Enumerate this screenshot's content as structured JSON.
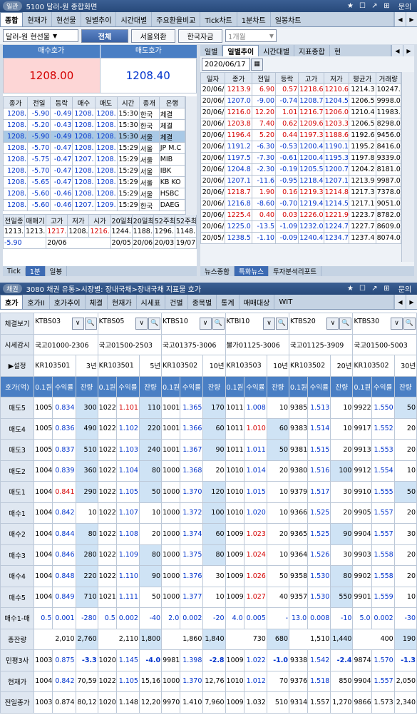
{
  "w1": {
    "tag": "일관",
    "title": "5100 달러-원 종합화면",
    "btns": [
      "★",
      "☐",
      "↗",
      "⊞",
      "문의"
    ],
    "tabs": [
      "종합",
      "현재가",
      "현선물",
      "일별추이",
      "시간대별",
      "주요환율비교",
      "Tick차트",
      "1분차트",
      "일봉차트"
    ],
    "sel": "달러-원 현선물",
    "b1": "전체",
    "b2": "서울외환",
    "b3": "한국자금",
    "b4": "1개월",
    "bid_label": "매수호가",
    "ask_label": "매도호가",
    "bid": "1208.00",
    "ask": "1208.40",
    "left_cols": [
      "종가",
      "전일",
      "등락",
      "매수",
      "매도",
      "시간",
      "종개",
      "은행"
    ],
    "left_rows": [
      [
        "1208.",
        "-5.90",
        "-0.49",
        "1208.",
        "1208.",
        "15:30",
        "한국",
        "체결"
      ],
      [
        "1208.",
        "-5.20",
        "-0.43",
        "1208.",
        "1208.",
        "15:30",
        "한국",
        "체결"
      ],
      [
        "1208.",
        "-5.90",
        "-0.49",
        "1208.",
        "1208.",
        "15:30",
        "서울",
        "체결"
      ],
      [
        "1208.",
        "-5.70",
        "-0.47",
        "1208.",
        "1208.",
        "15:29",
        "서울",
        "JP M.C"
      ],
      [
        "1208.",
        "-5.75",
        "-0.47",
        "1207.",
        "1208.",
        "15:29",
        "서울",
        "MIB"
      ],
      [
        "1208.",
        "-5.70",
        "-0.47",
        "1208.",
        "1208.",
        "15:29",
        "서울",
        "IBK"
      ],
      [
        "1208.",
        "-5.65",
        "-0.47",
        "1208.",
        "1208.",
        "15:29",
        "서울",
        "KB KO"
      ],
      [
        "1208.",
        "-5.60",
        "-0.46",
        "1208.",
        "1208.",
        "15:29",
        "서울",
        "HSBC"
      ],
      [
        "1208.",
        "-5.60",
        "-0.46",
        "1207.",
        "1209.",
        "15:29",
        "한국",
        "DAEG"
      ]
    ],
    "sum_cols": [
      "전일종",
      "매매기",
      "고가",
      "저가",
      "시가",
      "20일최",
      "20일최",
      "52주최",
      "52주최"
    ],
    "sum_r1": [
      "1213.",
      "1213.",
      "1217.",
      "1208.",
      "1216.",
      "1244.",
      "1188.",
      "1296.",
      "1148."
    ],
    "sum_r2": [
      "-5.90",
      "20/06",
      "20/05",
      "20/06",
      "20/03",
      "19/07"
    ],
    "right_tabs": [
      "일별",
      "일별추이",
      "시간대별",
      "지표종합",
      "현"
    ],
    "date": "2020/06/17",
    "right_cols": [
      "일자",
      "종가",
      "전일",
      "등락",
      "고가",
      "저가",
      "평균가",
      "거래량"
    ],
    "right_rows": [
      [
        "20/06/",
        "1213.9",
        "6.90",
        "0.57",
        "1218.6",
        "1210.6",
        "1214.3",
        "10247."
      ],
      [
        "20/06/",
        "1207.0",
        "-9.00",
        "-0.74",
        "1208.7",
        "1204.5",
        "1206.5",
        "9998.0"
      ],
      [
        "20/06/",
        "1216.0",
        "12.20",
        "1.01",
        "1216.7",
        "1206.0",
        "1210.4",
        "11983."
      ],
      [
        "20/06/",
        "1203.8",
        "7.40",
        "0.62",
        "1209.6",
        "1203.3",
        "1206.5",
        "8298.0"
      ],
      [
        "20/06/",
        "1196.4",
        "5.20",
        "0.44",
        "1197.3",
        "1188.6",
        "1192.6",
        "9456.0"
      ],
      [
        "20/06/",
        "1191.2",
        "-6.30",
        "-0.53",
        "1200.4",
        "1190.1",
        "1195.2",
        "8416.0"
      ],
      [
        "20/06/",
        "1197.5",
        "-7.30",
        "-0.61",
        "1200.4",
        "1195.3",
        "1197.8",
        "9339.0"
      ],
      [
        "20/06/",
        "1204.8",
        "-2.30",
        "-0.19",
        "1205.5",
        "1200.7",
        "1204.2",
        "8181.0"
      ],
      [
        "20/06/",
        "1207.1",
        "-11.6",
        "-0.95",
        "1218.4",
        "1207.1",
        "1213.9",
        "9987.0"
      ],
      [
        "20/06/",
        "1218.7",
        "1.90",
        "0.16",
        "1219.3",
        "1214.8",
        "1217.3",
        "7378.0"
      ],
      [
        "20/06/",
        "1216.8",
        "-8.60",
        "-0.70",
        "1219.4",
        "1214.5",
        "1217.1",
        "9051.0"
      ],
      [
        "20/06/",
        "1225.4",
        "0.40",
        "0.03",
        "1226.0",
        "1221.9",
        "1223.7",
        "8782.0"
      ],
      [
        "20/06/",
        "1225.0",
        "-13.5",
        "-1.09",
        "1232.0",
        "1224.7",
        "1227.7",
        "8609.0"
      ],
      [
        "20/05/",
        "1238.5",
        "-1.10",
        "-0.09",
        "1240.4",
        "1234.7",
        "1237.4",
        "8074.0"
      ]
    ],
    "left_bottom_tabs": [
      "Tick",
      "1분",
      "일봉"
    ],
    "right_bottom_tabs": [
      "뉴스종합",
      "특화뉴스",
      "투자분석리포트"
    ]
  },
  "w2": {
    "tag": "채권",
    "title": "3080 채권 유통>시장별: 장내국채>장내국채 지표물 호가",
    "btns": [
      "★",
      "☐",
      "↗",
      "⊞",
      "문의"
    ],
    "tabs": [
      "호가",
      "호가II",
      "호가추이",
      "체결",
      "현재가",
      "시세표",
      "건별",
      "종목별",
      "통계",
      "매매대상",
      "WIT"
    ],
    "side": [
      "체결보기",
      "시세감시",
      "설정",
      "호가(억)",
      "매도5",
      "매도4",
      "매도3",
      "매도2",
      "매도1",
      "매수1",
      "매수2",
      "매수3",
      "매수4",
      "매수5",
      "매수1-매",
      "총잔량",
      "민평3사",
      "현재가",
      "전일종가"
    ],
    "cols": [
      {
        "code": "KTBS03",
        "name": "국고01000-2306",
        "isin": "KR103501",
        "term": "3년",
        "q": [
          [
            "1005",
            "0.834",
            "300",
            "b"
          ],
          [
            "1005",
            "0.836",
            "490",
            "b"
          ],
          [
            "1005",
            "0.837",
            "510",
            "b"
          ],
          [
            "1004",
            "0.839",
            "360",
            "b"
          ],
          [
            "1004",
            "0.841",
            "290",
            "r"
          ],
          [
            "1004",
            "0.842",
            "10",
            "b"
          ],
          [
            "1004",
            "0.844",
            "80",
            "b"
          ],
          [
            "1004",
            "0.846",
            "280",
            "b"
          ],
          [
            "1004",
            "0.848",
            "220",
            "b"
          ],
          [
            "1004",
            "0.849",
            "710",
            "b"
          ]
        ],
        "diff": [
          "0.5",
          "0.001",
          "-280"
        ],
        "tot": [
          "2,010",
          "2,760"
        ],
        "mp": [
          "1003",
          "0.875",
          "-3.3"
        ],
        "cur": [
          "1004",
          "0.842",
          "70,59"
        ],
        "prev": [
          "1003",
          "0.874",
          "80,12"
        ]
      },
      {
        "code": "KTBS05",
        "name": "국고01500-2503",
        "isin": "KR103501",
        "term": "5년",
        "q": [
          [
            "1022",
            "1.101",
            "110",
            "r"
          ],
          [
            "1022",
            "1.102",
            "220",
            "b"
          ],
          [
            "1022",
            "1.103",
            "240",
            "b"
          ],
          [
            "1022",
            "1.104",
            "80",
            "b"
          ],
          [
            "1022",
            "1.105",
            "50",
            "b"
          ],
          [
            "1022",
            "1.107",
            "10",
            "b"
          ],
          [
            "1022",
            "1.108",
            "20",
            "b"
          ],
          [
            "1022",
            "1.109",
            "80",
            "b"
          ],
          [
            "1022",
            "1.110",
            "90",
            "b"
          ],
          [
            "1021",
            "1.111",
            "50",
            "b"
          ]
        ],
        "diff": [
          "0.5",
          "0.002",
          "-40"
        ],
        "tot": [
          "2,110",
          "1,800"
        ],
        "mp": [
          "1020",
          "1.145",
          "-4.0"
        ],
        "cur": [
          "1022",
          "1.105",
          "15,16"
        ],
        "prev": [
          "1020",
          "1.148",
          "12,20"
        ]
      },
      {
        "code": "KTBS10",
        "name": "국고01375-3006",
        "isin": "KR103502",
        "term": "10년",
        "q": [
          [
            "1001",
            "1.365",
            "170",
            "b"
          ],
          [
            "1001",
            "1.366",
            "60",
            "b"
          ],
          [
            "1001",
            "1.367",
            "90",
            "b"
          ],
          [
            "1000",
            "1.368",
            "20",
            "b"
          ],
          [
            "1000",
            "1.370",
            "120",
            "b"
          ],
          [
            "1000",
            "1.372",
            "100",
            "b"
          ],
          [
            "1000",
            "1.374",
            "60",
            "b"
          ],
          [
            "1000",
            "1.375",
            "80",
            "b"
          ],
          [
            "1000",
            "1.376",
            "30",
            "b"
          ],
          [
            "1000",
            "1.377",
            "10",
            "b"
          ]
        ],
        "diff": [
          "2.0",
          "0.002",
          "-20"
        ],
        "tot": [
          "1,860",
          "1,840"
        ],
        "mp": [
          "9981",
          "1.398",
          "-2.8"
        ],
        "cur": [
          "1000",
          "1.370",
          "12,76"
        ],
        "prev": [
          "9970",
          "1.410",
          "7,960"
        ]
      },
      {
        "code": "KTBI10",
        "name": "물가01125-3006",
        "isin": "KR103503",
        "term": "10년",
        "q": [
          [
            "1011",
            "1.008",
            "10",
            "b"
          ],
          [
            "1011",
            "1.010",
            "60",
            "r"
          ],
          [
            "1011",
            "1.011",
            "50",
            "b"
          ],
          [
            "1010",
            "1.014",
            "20",
            "b"
          ],
          [
            "1010",
            "1.015",
            "10",
            "b"
          ],
          [
            "1010",
            "1.020",
            "10",
            "b"
          ],
          [
            "1009",
            "1.023",
            "20",
            "r"
          ],
          [
            "1009",
            "1.024",
            "10",
            "r"
          ],
          [
            "1009",
            "1.026",
            "50",
            "r"
          ],
          [
            "1009",
            "1.027",
            "40",
            "r"
          ]
        ],
        "diff": [
          "4.0",
          "0.005",
          "-"
        ],
        "tot": [
          "730",
          "680"
        ],
        "mp": [
          "1009",
          "1.022",
          "-1.0"
        ],
        "cur": [
          "1010",
          "1.012",
          "70"
        ],
        "prev": [
          "1009",
          "1.032",
          "510"
        ]
      },
      {
        "code": "KTBS20",
        "name": "국고01125-3909",
        "isin": "KR103502",
        "term": "20년",
        "q": [
          [
            "9385",
            "1.513",
            "10",
            "b"
          ],
          [
            "9383",
            "1.514",
            "10",
            "b"
          ],
          [
            "9381",
            "1.515",
            "20",
            "b"
          ],
          [
            "9380",
            "1.516",
            "100",
            "b"
          ],
          [
            "9379",
            "1.517",
            "30",
            "b"
          ],
          [
            "9366",
            "1.525",
            "20",
            "b"
          ],
          [
            "9365",
            "1.525",
            "90",
            "b"
          ],
          [
            "9364",
            "1.526",
            "30",
            "b"
          ],
          [
            "9358",
            "1.530",
            "80",
            "b"
          ],
          [
            "9357",
            "1.530",
            "550",
            "b"
          ]
        ],
        "diff": [
          "13.0",
          "0.008",
          "-10"
        ],
        "tot": [
          "1,510",
          "1,440"
        ],
        "mp": [
          "9338",
          "1.542",
          "-2.4"
        ],
        "cur": [
          "9376",
          "1.518",
          "850"
        ],
        "prev": [
          "9314",
          "1.557",
          "1,270"
        ]
      },
      {
        "code": "KTBS30",
        "name": "국고01500-5003",
        "isin": "KR103502",
        "term": "30년",
        "q": [
          [
            "9922",
            "1.550",
            "50",
            "b"
          ],
          [
            "9917",
            "1.552",
            "20",
            "b"
          ],
          [
            "9913",
            "1.553",
            "20",
            "b"
          ],
          [
            "9912",
            "1.554",
            "10",
            "b"
          ],
          [
            "9910",
            "1.555",
            "50",
            "b"
          ],
          [
            "9905",
            "1.557",
            "20",
            "b"
          ],
          [
            "9904",
            "1.557",
            "30",
            "b"
          ],
          [
            "9903",
            "1.558",
            "20",
            "b"
          ],
          [
            "9902",
            "1.558",
            "20",
            "b"
          ],
          [
            "9901",
            "1.559",
            "10",
            "b"
          ]
        ],
        "diff": [
          "5.0",
          "0.002",
          "-30"
        ],
        "tot": [
          "400",
          "190"
        ],
        "mp": [
          "9874",
          "1.570",
          "-1.3"
        ],
        "cur": [
          "9904",
          "1.557",
          "2,050"
        ],
        "prev": [
          "9866",
          "1.573",
          "2,340"
        ]
      }
    ],
    "sub": [
      "0.1원",
      "수익률",
      "잔량"
    ],
    "btns_sq": [
      "∨",
      "🔍"
    ]
  }
}
